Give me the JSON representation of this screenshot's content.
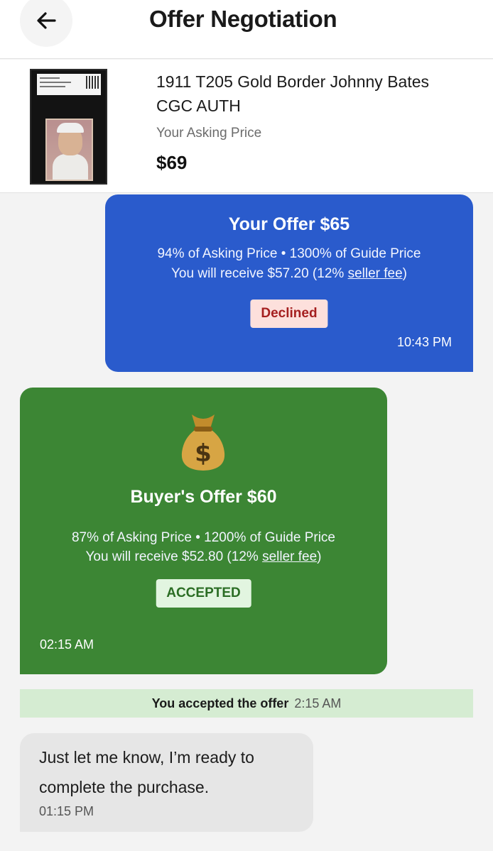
{
  "header": {
    "title": "Offer Negotiation",
    "back_icon": "arrow-left-icon"
  },
  "product": {
    "title": "1911 T205 Gold Border Johnny Bates CGC AUTH",
    "asking_label": "Your Asking Price",
    "asking_price": "$69"
  },
  "your_offer": {
    "title": "Your Offer $65",
    "line1": "94% of Asking Price • 1300% of Guide Price",
    "line2_prefix": "You will receive $57.20 (12% ",
    "fee_link": "seller fee",
    "line2_suffix": ")",
    "status": "Declined",
    "time": "10:43 PM"
  },
  "buyer_offer": {
    "icon": "money-bag-icon",
    "title": "Buyer's Offer $60",
    "line1": "87% of Asking Price • 1200% of Guide Price",
    "line2_prefix": "You will receive $52.80 (12% ",
    "fee_link": "seller fee",
    "line2_suffix": ")",
    "status": "ACCEPTED",
    "time": "02:15 AM"
  },
  "system_message": {
    "text": "You accepted the offer",
    "time": "2:15 AM"
  },
  "chat_message": {
    "text": "Just let me know, I’m ready to complete the purchase.",
    "time": "01:15 PM"
  },
  "colors": {
    "your_offer_bg": "#2a5bcc",
    "buyer_offer_bg": "#3c8634",
    "system_bg": "#d5ecd2",
    "declined_badge": "#fde0dc",
    "accepted_badge": "#e2f5e0"
  }
}
